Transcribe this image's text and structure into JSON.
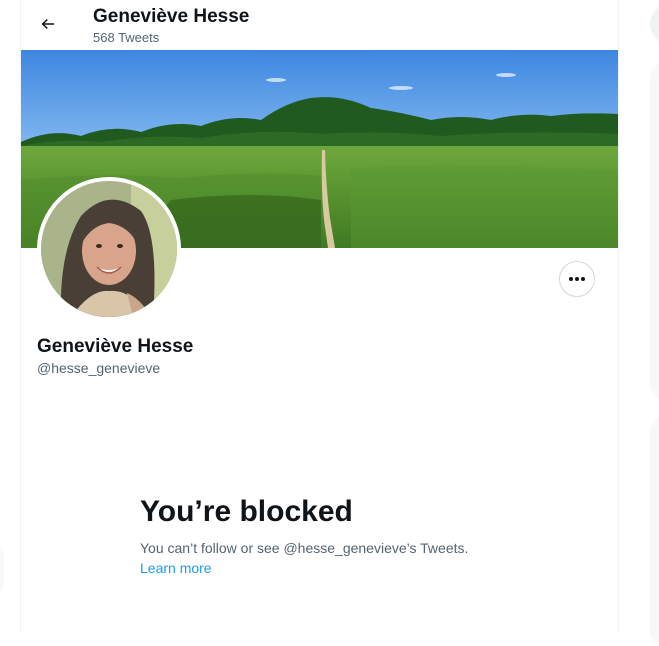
{
  "header": {
    "name": "Geneviève Hesse",
    "tweet_count": "568 Tweets"
  },
  "profile": {
    "name": "Geneviève Hesse",
    "handle": "@hesse_genevieve"
  },
  "blocked": {
    "title": "You’re blocked",
    "message": "You can’t follow or see @hesse_genevieve’s Tweets.",
    "learn_more": "Learn more"
  },
  "icons": {
    "back": "back-arrow-icon",
    "more": "more-dots-icon"
  },
  "colors": {
    "link": "#1d9bf0",
    "secondary_text": "#536471",
    "primary_text": "#0f1419"
  }
}
